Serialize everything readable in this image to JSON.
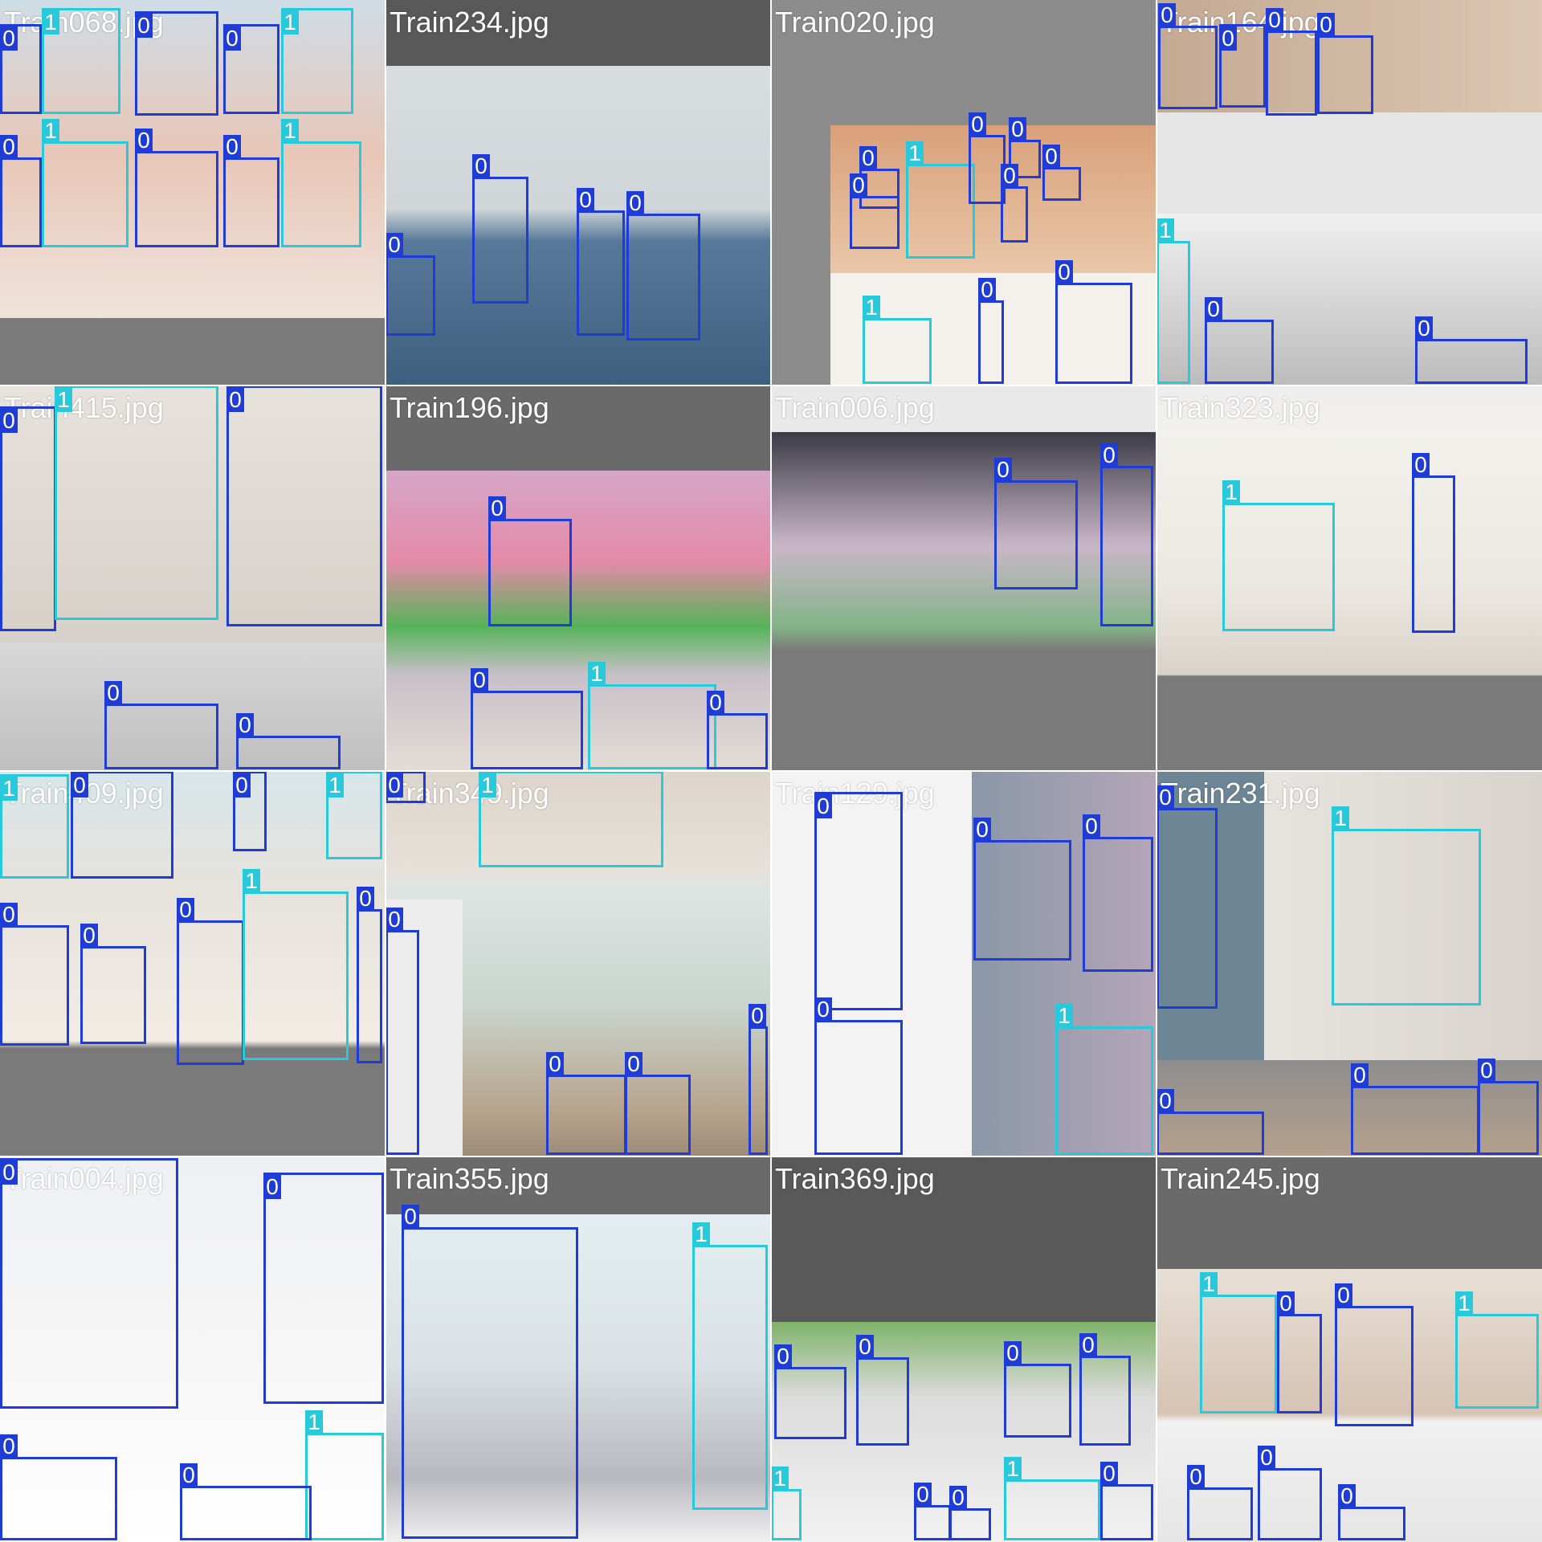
{
  "title": "",
  "class_colors": {
    "0": "#1f3dd6",
    "1": "#29c9dc"
  },
  "tiles": [
    {
      "filename": "Train068.jpg",
      "boxes": [
        {
          "cls": "0",
          "l": 0,
          "t": 30,
          "w": 52,
          "h": 112
        },
        {
          "cls": "1",
          "l": 52,
          "t": 10,
          "w": 98,
          "h": 132
        },
        {
          "cls": "0",
          "l": 168,
          "t": 14,
          "w": 104,
          "h": 130
        },
        {
          "cls": "0",
          "l": 278,
          "t": 30,
          "w": 70,
          "h": 112
        },
        {
          "cls": "1",
          "l": 350,
          "t": 10,
          "w": 90,
          "h": 132
        },
        {
          "cls": "0",
          "l": 0,
          "t": 196,
          "w": 52,
          "h": 112
        },
        {
          "cls": "1",
          "l": 52,
          "t": 176,
          "w": 108,
          "h": 132
        },
        {
          "cls": "0",
          "l": 168,
          "t": 188,
          "w": 104,
          "h": 120
        },
        {
          "cls": "0",
          "l": 278,
          "t": 196,
          "w": 70,
          "h": 112
        },
        {
          "cls": "1",
          "l": 350,
          "t": 176,
          "w": 100,
          "h": 132
        }
      ]
    },
    {
      "filename": "Train234.jpg",
      "boxes": [
        {
          "cls": "0",
          "l": 108,
          "t": 220,
          "w": 70,
          "h": 158
        },
        {
          "cls": "0",
          "l": 0,
          "t": 318,
          "w": 62,
          "h": 100
        },
        {
          "cls": "0",
          "l": 238,
          "t": 262,
          "w": 60,
          "h": 156
        },
        {
          "cls": "0",
          "l": 300,
          "t": 266,
          "w": 92,
          "h": 158
        }
      ]
    },
    {
      "filename": "Train020.jpg",
      "boxes": [
        {
          "cls": "0",
          "l": 110,
          "t": 210,
          "w": 50,
          "h": 50
        },
        {
          "cls": "1",
          "l": 168,
          "t": 204,
          "w": 86,
          "h": 118
        },
        {
          "cls": "0",
          "l": 98,
          "t": 244,
          "w": 62,
          "h": 66
        },
        {
          "cls": "0",
          "l": 246,
          "t": 168,
          "w": 46,
          "h": 86
        },
        {
          "cls": "0",
          "l": 296,
          "t": 174,
          "w": 40,
          "h": 48
        },
        {
          "cls": "0",
          "l": 286,
          "t": 232,
          "w": 34,
          "h": 70
        },
        {
          "cls": "0",
          "l": 338,
          "t": 208,
          "w": 48,
          "h": 42
        },
        {
          "cls": "1",
          "l": 114,
          "t": 396,
          "w": 86,
          "h": 82
        },
        {
          "cls": "0",
          "l": 258,
          "t": 374,
          "w": 32,
          "h": 104
        },
        {
          "cls": "0",
          "l": 354,
          "t": 352,
          "w": 96,
          "h": 126
        }
      ]
    },
    {
      "filename": "Train164.jpg",
      "boxes": [
        {
          "cls": "0",
          "l": 2,
          "t": 32,
          "w": 74,
          "h": 104
        },
        {
          "cls": "0",
          "l": 78,
          "t": 30,
          "w": 58,
          "h": 104
        },
        {
          "cls": "0",
          "l": 136,
          "t": 38,
          "w": 64,
          "h": 106
        },
        {
          "cls": "0",
          "l": 200,
          "t": 44,
          "w": 70,
          "h": 98
        },
        {
          "cls": "1",
          "l": 0,
          "t": 300,
          "w": 42,
          "h": 178
        },
        {
          "cls": "0",
          "l": 60,
          "t": 398,
          "w": 86,
          "h": 80
        },
        {
          "cls": "0",
          "l": 322,
          "t": 422,
          "w": 140,
          "h": 56
        }
      ]
    },
    {
      "filename": "Train415.jpg",
      "boxes": [
        {
          "cls": "0",
          "l": 0,
          "t": 26,
          "w": 70,
          "h": 280
        },
        {
          "cls": "1",
          "l": 68,
          "t": 0,
          "w": 204,
          "h": 292
        },
        {
          "cls": "0",
          "l": 282,
          "t": 0,
          "w": 194,
          "h": 300
        },
        {
          "cls": "0",
          "l": 130,
          "t": 396,
          "w": 142,
          "h": 82
        },
        {
          "cls": "0",
          "l": 294,
          "t": 436,
          "w": 130,
          "h": 42
        }
      ]
    },
    {
      "filename": "Train196.jpg",
      "boxes": [
        {
          "cls": "0",
          "l": 128,
          "t": 166,
          "w": 104,
          "h": 134
        },
        {
          "cls": "0",
          "l": 106,
          "t": 380,
          "w": 140,
          "h": 98
        },
        {
          "cls": "1",
          "l": 252,
          "t": 372,
          "w": 160,
          "h": 106
        },
        {
          "cls": "0",
          "l": 400,
          "t": 408,
          "w": 76,
          "h": 70
        }
      ]
    },
    {
      "filename": "Train006.jpg",
      "boxes": [
        {
          "cls": "0",
          "l": 278,
          "t": 118,
          "w": 104,
          "h": 136
        },
        {
          "cls": "0",
          "l": 410,
          "t": 100,
          "w": 66,
          "h": 200
        }
      ]
    },
    {
      "filename": "Train323.jpg",
      "boxes": [
        {
          "cls": "1",
          "l": 82,
          "t": 146,
          "w": 140,
          "h": 160
        },
        {
          "cls": "0",
          "l": 318,
          "t": 112,
          "w": 54,
          "h": 196
        }
      ]
    },
    {
      "filename": "Train409.jpg",
      "boxes": [
        {
          "cls": "1",
          "l": 0,
          "t": 4,
          "w": 86,
          "h": 130
        },
        {
          "cls": "0",
          "l": 88,
          "t": 0,
          "w": 128,
          "h": 134
        },
        {
          "cls": "0",
          "l": 290,
          "t": 0,
          "w": 42,
          "h": 100
        },
        {
          "cls": "1",
          "l": 406,
          "t": 0,
          "w": 70,
          "h": 110
        },
        {
          "cls": "0",
          "l": 0,
          "t": 192,
          "w": 86,
          "h": 150
        },
        {
          "cls": "0",
          "l": 100,
          "t": 218,
          "w": 82,
          "h": 122
        },
        {
          "cls": "0",
          "l": 220,
          "t": 186,
          "w": 84,
          "h": 180
        },
        {
          "cls": "1",
          "l": 302,
          "t": 150,
          "w": 132,
          "h": 210
        },
        {
          "cls": "0",
          "l": 444,
          "t": 172,
          "w": 32,
          "h": 192
        }
      ]
    },
    {
      "filename": "Train349.jpg",
      "boxes": [
        {
          "cls": "0",
          "l": 0,
          "t": 0,
          "w": 50,
          "h": 40
        },
        {
          "cls": "1",
          "l": 116,
          "t": 0,
          "w": 230,
          "h": 120
        },
        {
          "cls": "0",
          "l": 0,
          "t": 198,
          "w": 42,
          "h": 280
        },
        {
          "cls": "0",
          "l": 200,
          "t": 378,
          "w": 100,
          "h": 100
        },
        {
          "cls": "0",
          "l": 298,
          "t": 378,
          "w": 82,
          "h": 100
        },
        {
          "cls": "0",
          "l": 452,
          "t": 318,
          "w": 24,
          "h": 160
        }
      ]
    },
    {
      "filename": "Train129.jpg",
      "boxes": [
        {
          "cls": "0",
          "l": 54,
          "t": 26,
          "w": 110,
          "h": 272
        },
        {
          "cls": "0",
          "l": 252,
          "t": 86,
          "w": 122,
          "h": 150
        },
        {
          "cls": "0",
          "l": 388,
          "t": 82,
          "w": 88,
          "h": 168
        },
        {
          "cls": "0",
          "l": 54,
          "t": 310,
          "w": 110,
          "h": 168
        },
        {
          "cls": "1",
          "l": 354,
          "t": 318,
          "w": 122,
          "h": 160
        }
      ]
    },
    {
      "filename": "Train231.jpg",
      "boxes": [
        {
          "cls": "0",
          "l": 0,
          "t": 46,
          "w": 76,
          "h": 250
        },
        {
          "cls": "1",
          "l": 218,
          "t": 72,
          "w": 186,
          "h": 220
        },
        {
          "cls": "0",
          "l": 0,
          "t": 424,
          "w": 134,
          "h": 54
        },
        {
          "cls": "0",
          "l": 242,
          "t": 392,
          "w": 160,
          "h": 86
        },
        {
          "cls": "0",
          "l": 400,
          "t": 386,
          "w": 76,
          "h": 92
        }
      ]
    },
    {
      "filename": "Train004.jpg",
      "boxes": [
        {
          "cls": "0",
          "l": 0,
          "t": 2,
          "w": 222,
          "h": 312
        },
        {
          "cls": "0",
          "l": 328,
          "t": 20,
          "w": 150,
          "h": 288
        },
        {
          "cls": "1",
          "l": 380,
          "t": 344,
          "w": 98,
          "h": 134
        },
        {
          "cls": "0",
          "l": 0,
          "t": 374,
          "w": 146,
          "h": 104
        },
        {
          "cls": "0",
          "l": 224,
          "t": 410,
          "w": 164,
          "h": 68
        }
      ]
    },
    {
      "filename": "Train355.jpg",
      "boxes": [
        {
          "cls": "0",
          "l": 20,
          "t": 88,
          "w": 220,
          "h": 388
        },
        {
          "cls": "1",
          "l": 382,
          "t": 110,
          "w": 94,
          "h": 330
        }
      ]
    },
    {
      "filename": "Train369.jpg",
      "boxes": [
        {
          "cls": "0",
          "l": 4,
          "t": 262,
          "w": 90,
          "h": 90
        },
        {
          "cls": "0",
          "l": 106,
          "t": 250,
          "w": 66,
          "h": 110
        },
        {
          "cls": "0",
          "l": 290,
          "t": 258,
          "w": 84,
          "h": 92
        },
        {
          "cls": "0",
          "l": 384,
          "t": 248,
          "w": 64,
          "h": 112
        },
        {
          "cls": "1",
          "l": 0,
          "t": 414,
          "w": 38,
          "h": 64
        },
        {
          "cls": "0",
          "l": 178,
          "t": 434,
          "w": 46,
          "h": 44
        },
        {
          "cls": "0",
          "l": 222,
          "t": 438,
          "w": 52,
          "h": 40
        },
        {
          "cls": "1",
          "l": 290,
          "t": 402,
          "w": 120,
          "h": 76
        },
        {
          "cls": "0",
          "l": 410,
          "t": 408,
          "w": 66,
          "h": 70
        }
      ]
    },
    {
      "filename": "Train245.jpg",
      "boxes": [
        {
          "cls": "1",
          "l": 54,
          "t": 172,
          "w": 96,
          "h": 148
        },
        {
          "cls": "0",
          "l": 150,
          "t": 196,
          "w": 56,
          "h": 124
        },
        {
          "cls": "0",
          "l": 222,
          "t": 186,
          "w": 98,
          "h": 150
        },
        {
          "cls": "1",
          "l": 372,
          "t": 196,
          "w": 104,
          "h": 118
        },
        {
          "cls": "0",
          "l": 38,
          "t": 412,
          "w": 82,
          "h": 66
        },
        {
          "cls": "0",
          "l": 126,
          "t": 388,
          "w": 80,
          "h": 90
        },
        {
          "cls": "0",
          "l": 226,
          "t": 436,
          "w": 84,
          "h": 42
        }
      ]
    }
  ]
}
